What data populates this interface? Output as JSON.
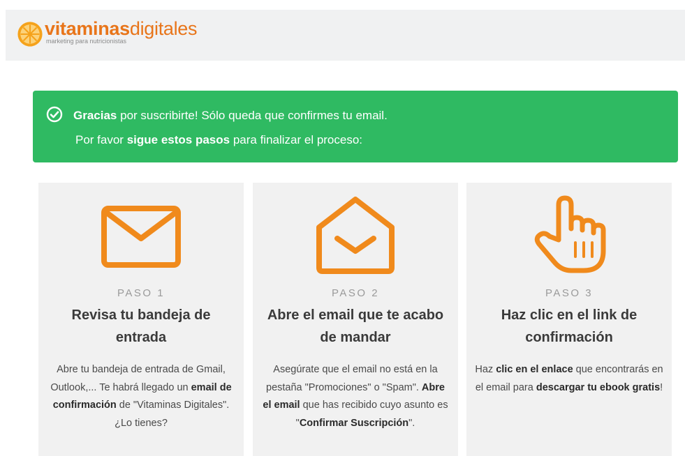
{
  "brand": {
    "name_bold": "vitaminas",
    "name_light": "digitales",
    "tagline": "marketing para nutricionistas",
    "color": "#e8751a"
  },
  "alert": {
    "color": "#2fba62",
    "icon": "check-circle-icon",
    "line1_bold": "Gracias",
    "line1_rest": " por suscribirte! Sólo queda que confirmes tu email.",
    "line2_pre": "Por favor ",
    "line2_bold": "sigue estos pasos",
    "line2_post": " para finalizar el proceso:"
  },
  "steps": [
    {
      "icon": "envelope-icon",
      "label": "PASO 1",
      "title": "Revisa tu bandeja de entrada",
      "desc": [
        {
          "t": "Abre tu bandeja de entrada de Gmail, Outlook,... Te habrá llegado un ",
          "b": false
        },
        {
          "t": "email de confirmación",
          "b": true
        },
        {
          "t": " de \"Vitaminas Digitales\". ¿Lo tienes?",
          "b": false
        }
      ]
    },
    {
      "icon": "open-envelope-icon",
      "label": "PASO 2",
      "title": "Abre el email que te acabo de mandar",
      "desc": [
        {
          "t": "Asegúrate que el email no está en la pestaña \"Promociones\" o \"Spam\". ",
          "b": false
        },
        {
          "t": "Abre el email",
          "b": true
        },
        {
          "t": " que has recibido cuyo asunto es \"",
          "b": false
        },
        {
          "t": "Confirmar Suscripción",
          "b": true
        },
        {
          "t": "\".",
          "b": false
        }
      ]
    },
    {
      "icon": "pointing-hand-icon",
      "label": "PASO 3",
      "title": "Haz clic en el link de confirmación",
      "desc": [
        {
          "t": "Haz ",
          "b": false
        },
        {
          "t": "clic en el enlace",
          "b": true
        },
        {
          "t": " que encontrarás en el email para ",
          "b": false
        },
        {
          "t": "descargar tu ebook gratis",
          "b": true
        },
        {
          "t": "!",
          "b": false
        }
      ]
    }
  ]
}
